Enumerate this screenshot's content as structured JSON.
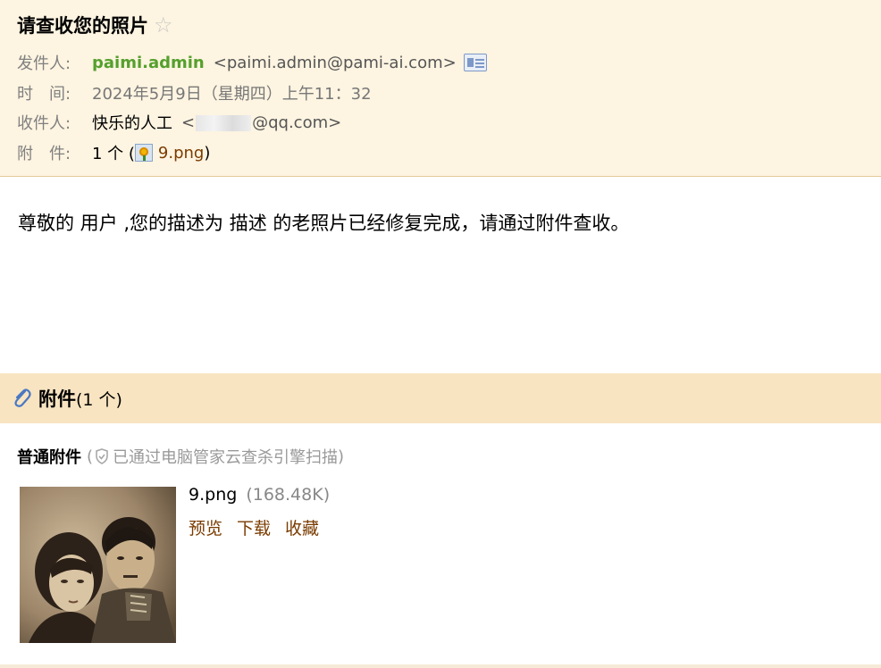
{
  "header": {
    "subject": "请查收您的照片",
    "star_glyph": "☆",
    "sender_label": "发件人:",
    "sender_name": "paimi.admin",
    "sender_address": "<paimi.admin@pami-ai.com>",
    "time_label": "时　间:",
    "time_value": "2024年5月9日（星期四）上午11：32",
    "recipient_label": "收件人:",
    "recipient_name": "快乐的人工",
    "recipient_addr_prefix": "<",
    "recipient_addr_suffix": "@qq.com>",
    "attach_label": "附　件:",
    "attach_count": "1 个 (",
    "attach_file": "9.png",
    "attach_close": ")"
  },
  "body": {
    "text": "尊敬的 用户 ,您的描述为 描述 的老照片已经修复完成，请通过附件查收。"
  },
  "attachments": {
    "title": "附件",
    "count": "(1 个)",
    "normal_label": "普通附件",
    "scan_open": "(",
    "scan_text": "已通过电脑管家云查杀引擎扫描",
    "scan_close": ")",
    "file": {
      "name": "9.png",
      "size": "(168.48K)",
      "actions": [
        "预览",
        "下载",
        "收藏"
      ]
    }
  },
  "colors": {
    "header_bg": "#fdf4e1",
    "sender_green": "#55a02d",
    "link_brown": "#7a3b00",
    "section_bg": "#f8e4c1"
  },
  "icons": [
    "star-icon",
    "contact-card-icon",
    "png-file-icon",
    "paperclip-icon",
    "shield-icon"
  ]
}
